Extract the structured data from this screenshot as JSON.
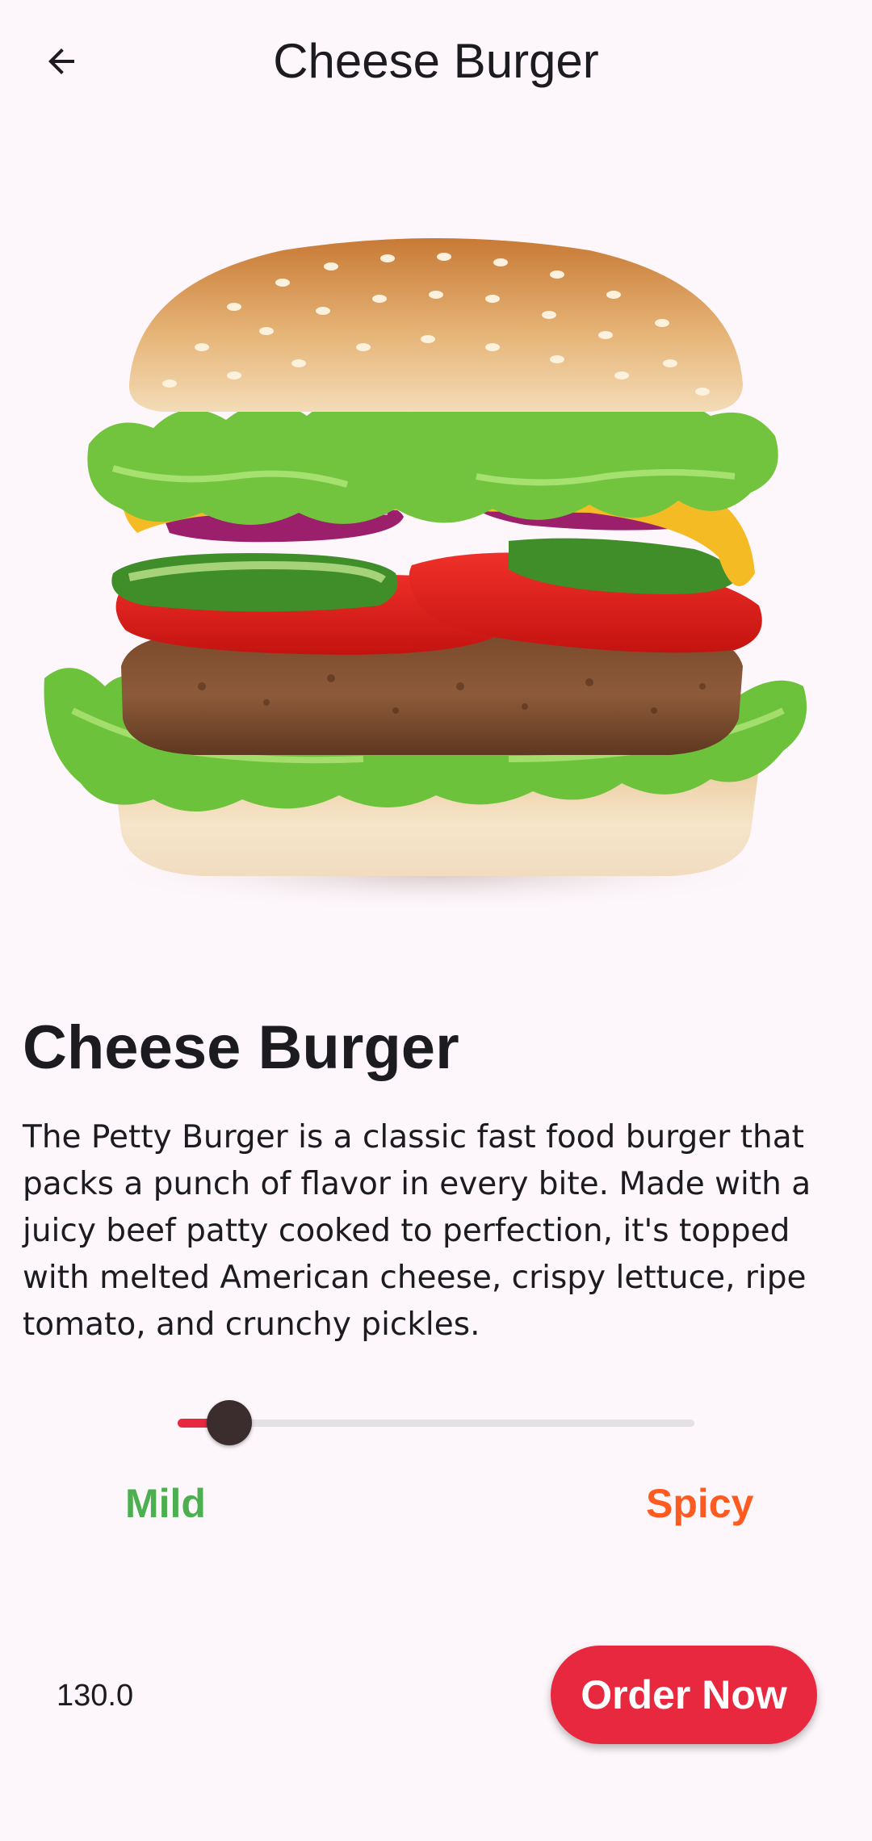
{
  "app_bar": {
    "title": "Cheese Burger",
    "back_icon": "arrow-back-icon"
  },
  "product": {
    "image_icon": "burger-image",
    "name": "Cheese Burger",
    "description": "The Petty Burger is a classic fast food burger that packs a punch of flavor in every bite. Made with a juicy beef patty cooked to perfection, it's topped with melted American cheese, crispy lettuce, ripe tomato, and crunchy pickles."
  },
  "spice": {
    "level": 0.1,
    "min_label": "Mild",
    "max_label": "Spicy",
    "min_color": "#4caf50",
    "max_color": "#ff5a1f",
    "active_color": "#e8283f"
  },
  "order": {
    "price": "130.0",
    "button_label": "Order Now",
    "accent": "#e8283f"
  }
}
